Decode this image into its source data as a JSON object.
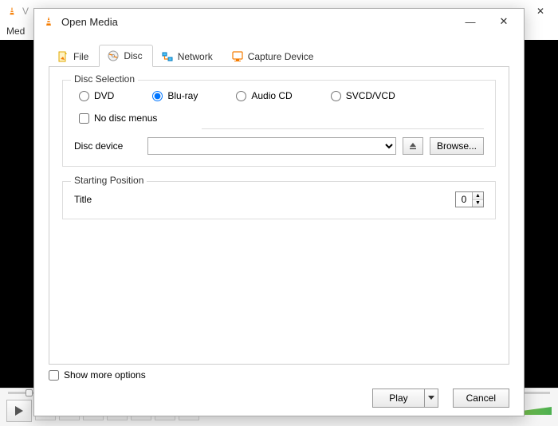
{
  "bg": {
    "title_fragment": "V",
    "menu_media": "Med",
    "win_min": "—",
    "win_close": "✕"
  },
  "dialog": {
    "title": "Open Media",
    "win_min": "—",
    "win_close": "✕",
    "tabs": {
      "file": "File",
      "disc": "Disc",
      "network": "Network",
      "capture": "Capture Device"
    },
    "disc_selection": {
      "legend": "Disc Selection",
      "dvd": "DVD",
      "bluray": "Blu-ray",
      "audio_cd": "Audio CD",
      "svcd_vcd": "SVCD/VCD",
      "selected": "bluray",
      "no_disc_menus": "No disc menus",
      "no_disc_menus_checked": false,
      "device_label": "Disc device",
      "device_value": "",
      "browse": "Browse..."
    },
    "starting_position": {
      "legend": "Starting Position",
      "title_label": "Title",
      "title_value": "0"
    },
    "show_more_options": "Show more options",
    "show_more_checked": false,
    "play": "Play",
    "cancel": "Cancel"
  }
}
